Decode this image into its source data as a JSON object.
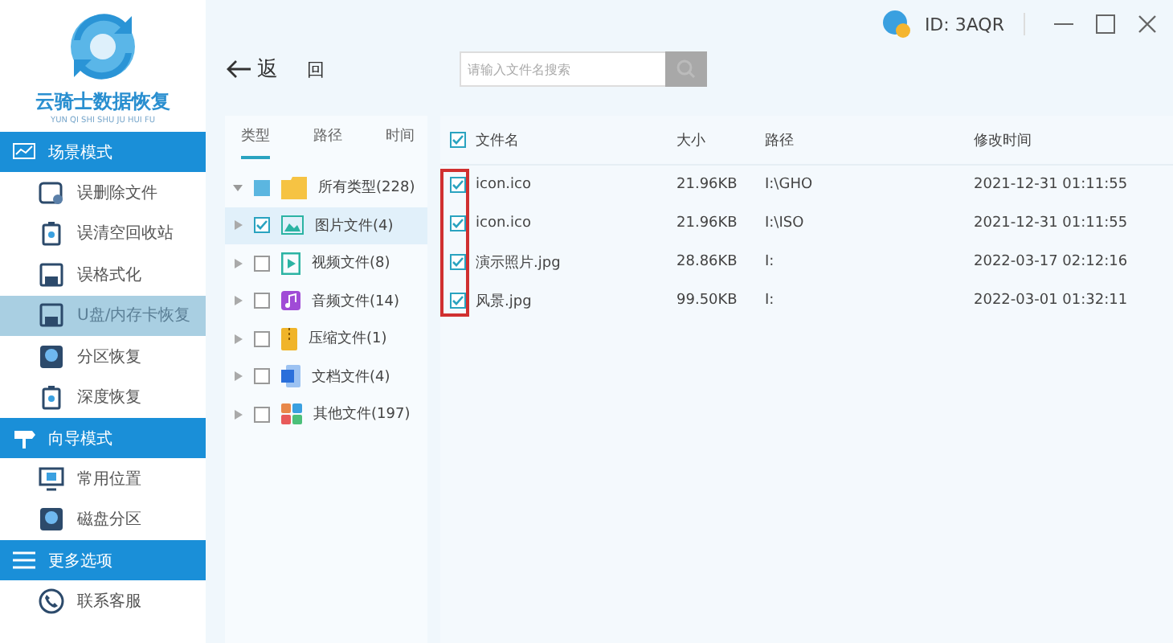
{
  "logo": {
    "title": "云骑士数据恢复",
    "subtitle": "YUN QI SHI SHU JU HUI FU"
  },
  "sidebar": {
    "sections": [
      {
        "title": "场景模式",
        "kind": "wave",
        "items": [
          {
            "label": "误删除文件",
            "kind": "file",
            "selected": false
          },
          {
            "label": "误清空回收站",
            "kind": "bin",
            "selected": false
          },
          {
            "label": "误格式化",
            "kind": "disk",
            "selected": false
          },
          {
            "label": "U盘/内存卡恢复",
            "kind": "disk",
            "selected": true
          },
          {
            "label": "分区恢复",
            "kind": "drive",
            "selected": false
          },
          {
            "label": "深度恢复",
            "kind": "bin",
            "selected": false
          }
        ]
      },
      {
        "title": "向导模式",
        "kind": "sign",
        "items": [
          {
            "label": "常用位置",
            "kind": "monitor",
            "selected": false
          },
          {
            "label": "磁盘分区",
            "kind": "drive",
            "selected": false
          }
        ]
      },
      {
        "title": "更多选项",
        "kind": "menu",
        "items": [
          {
            "label": "联系客服",
            "kind": "phone",
            "selected": false
          }
        ]
      }
    ]
  },
  "header": {
    "id_label": "ID: 3AQR"
  },
  "toolbar": {
    "back": "返",
    "back_suffix": "回",
    "search": {
      "placeholder": "请输入文件名搜索"
    }
  },
  "tree": {
    "tabs": [
      {
        "label": "类型",
        "selected": true
      },
      {
        "label": "路径",
        "selected": false
      },
      {
        "label": "时间",
        "selected": false
      }
    ],
    "root": {
      "label": "所有类型(228)",
      "kind": "folder",
      "checked": false,
      "indeterminate": true,
      "expanded": true,
      "children": [
        {
          "label": "图片文件(4)",
          "kind": "image",
          "checked": true,
          "selected": true
        },
        {
          "label": "视频文件(8)",
          "kind": "video",
          "checked": false,
          "selected": false
        },
        {
          "label": "音频文件(14)",
          "kind": "audio",
          "checked": false,
          "selected": false
        },
        {
          "label": "压缩文件(1)",
          "kind": "archive",
          "checked": false,
          "selected": false
        },
        {
          "label": "文档文件(4)",
          "kind": "document",
          "checked": false,
          "selected": false
        },
        {
          "label": "其他文件(197)",
          "kind": "other",
          "checked": false,
          "selected": false
        }
      ]
    }
  },
  "table": {
    "all_checked": true,
    "highlight_checkboxes": true,
    "columns": [
      "文件名",
      "大小",
      "路径",
      "修改时间"
    ],
    "rows": [
      {
        "checked": true,
        "cells": [
          "icon.ico",
          "21.96KB",
          "I:\\GHO",
          "2021-12-31 01:11:55"
        ]
      },
      {
        "checked": true,
        "cells": [
          "icon.ico",
          "21.96KB",
          "I:\\ISO",
          "2021-12-31 01:11:55"
        ]
      },
      {
        "checked": true,
        "cells": [
          "演示照片.jpg",
          "28.86KB",
          "I:",
          "2022-03-17 02:12:16"
        ]
      },
      {
        "checked": true,
        "cells": [
          "风景.jpg",
          "99.50KB",
          "I:",
          "2022-03-01 01:32:11"
        ]
      }
    ]
  }
}
